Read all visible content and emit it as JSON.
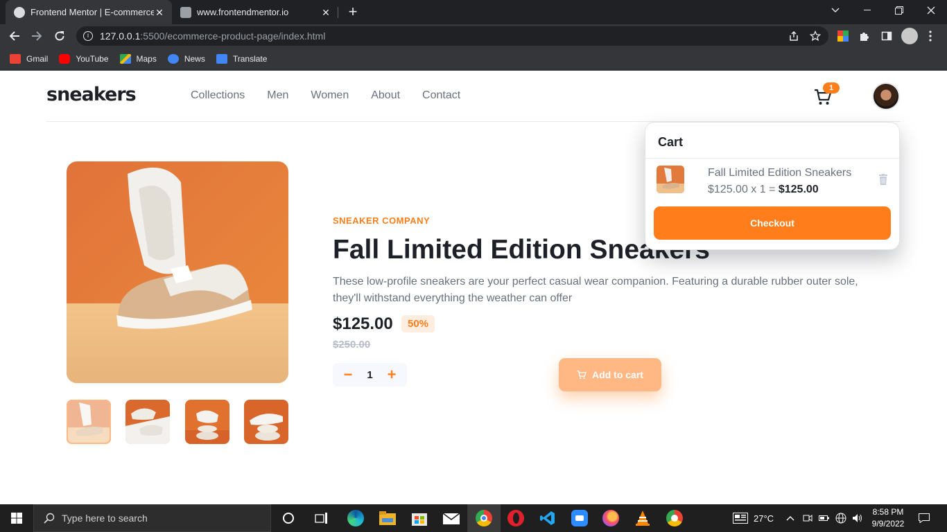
{
  "browser": {
    "tabs": [
      {
        "title": "Frontend Mentor | E-commerce P",
        "active": true
      },
      {
        "title": "www.frontendmentor.io",
        "active": false
      }
    ],
    "url_host": "127.0.0.1",
    "url_path": ":5500/ecommerce-product-page/index.html",
    "bookmarks": [
      "Gmail",
      "YouTube",
      "Maps",
      "News",
      "Translate"
    ]
  },
  "site": {
    "logo": "sneakers",
    "nav": [
      "Collections",
      "Men",
      "Women",
      "About",
      "Contact"
    ],
    "cart_count": "1"
  },
  "product": {
    "company": "SNEAKER COMPANY",
    "title": "Fall Limited Edition Sneakers",
    "description": "These low-profile sneakers are your perfect casual wear companion. Featuring a durable rubber outer sole, they'll withstand everything the weather can offer",
    "price": "$125.00",
    "discount": "50%",
    "old_price": "$250.00",
    "quantity": "1",
    "add_to_cart": "Add to cart",
    "minus": "−",
    "plus": "+"
  },
  "cart": {
    "heading": "Cart",
    "item_name": "Fall Limited Edition Sneakers",
    "item_calc": "$125.00 x 1 = ",
    "item_total": "$125.00",
    "checkout": "Checkout"
  },
  "taskbar": {
    "search_placeholder": "Type here to search",
    "weather": "27°C",
    "time": "8:58 PM",
    "date": "9/9/2022"
  },
  "colors": {
    "accent": "#ff7e1b",
    "accent_pale": "#ffede0",
    "dark": "#1d2026",
    "grey": "#69707d"
  }
}
